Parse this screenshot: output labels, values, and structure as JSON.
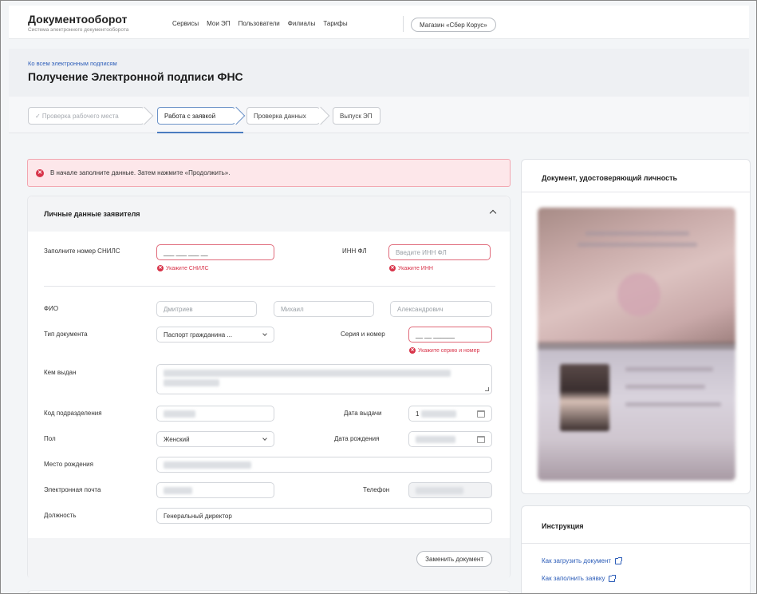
{
  "header": {
    "brand_title": "Документооборот",
    "brand_subtitle": "Система электронного документооборота",
    "nav": [
      "Сервисы",
      "Мои ЭП",
      "Пользователи",
      "Филиалы",
      "Тарифы"
    ],
    "store_button": "Магазин «Сбер Корус»"
  },
  "page": {
    "breadcrumb": "Ко всем электронным подписям",
    "title": "Получение Электронной подписи ФНС"
  },
  "steps": [
    {
      "label": "✓ Проверка рабочего места",
      "state": "done"
    },
    {
      "label": "Работа с заявкой",
      "state": "active"
    },
    {
      "label": "Проверка данных",
      "state": "pending"
    },
    {
      "label": "Выпуск ЭП",
      "state": "pending"
    }
  ],
  "alert": {
    "text": "В начале заполните данные. Затем нажмите «Продолжить»."
  },
  "applicant": {
    "title": "Личные данные заявителя",
    "snils_label": "Заполните номер СНИЛС",
    "snils_value": "___ ___ ___ __",
    "snils_error": "Укажите СНИЛС",
    "inn_label": "ИНН ФЛ",
    "inn_placeholder": "Введите ИНН ФЛ",
    "inn_error": "Укажите ИНН",
    "fio_label": "ФИО",
    "last_name": "Дмитриев",
    "first_name": "Михаил",
    "middle_name": "Александрович",
    "doc_type_label": "Тип документа",
    "doc_type_value": "Паспорт гражданина ...",
    "series_label": "Серия и номер",
    "series_value": "__ __ ______",
    "series_error": "Укажите серию и номер",
    "issued_by_label": "Кем выдан",
    "dept_code_label": "Код подразделения",
    "issue_date_label": "Дата выдачи",
    "issue_date_value": "1",
    "gender_label": "Пол",
    "gender_value": "Женский",
    "birth_date_label": "Дата рождения",
    "birth_place_label": "Место рождения",
    "email_label": "Электронная почта",
    "phone_label": "Телефон",
    "position_label": "Должность",
    "position_value": "Генеральный директор",
    "replace_button": "Заменить документ"
  },
  "document_panel": {
    "title": "Документ, удостоверяющий личность"
  },
  "instructions": {
    "title": "Инструкция",
    "links": [
      "Как загрузить документ",
      "Как заполнить заявку"
    ]
  },
  "colors": {
    "accent": "#2b5cb8",
    "error": "#d8344a",
    "alert_bg": "#fde7ea"
  }
}
